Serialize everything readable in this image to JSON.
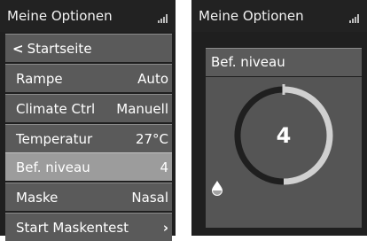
{
  "left_screen": {
    "title": "Meine Optionen",
    "back_label": "Startseite",
    "menu_items": [
      {
        "label": "Rampe",
        "value": "Auto"
      },
      {
        "label": "Climate Ctrl",
        "value": "Manuell"
      },
      {
        "label": "Temperatur",
        "value": "27°C"
      },
      {
        "label": "Bef. niveau",
        "value": "4",
        "selected": true
      },
      {
        "label": "Maske",
        "value": "Nasal"
      },
      {
        "label": "Start Maskentest",
        "value": "›"
      }
    ]
  },
  "right_screen": {
    "title": "Meine Optionen",
    "parameter_label": "Bef. niveau",
    "dial_value": "4",
    "dial_level_fraction": 0.5,
    "icon": "humidity-drop-icon"
  },
  "colors": {
    "screen_bg": "#1f1f1f",
    "row_bg": "#5a5a5a",
    "selected_row_bg": "#9c9c9c",
    "dial_track": "#d0d0d0",
    "dial_fill": "#1f1f1f"
  }
}
